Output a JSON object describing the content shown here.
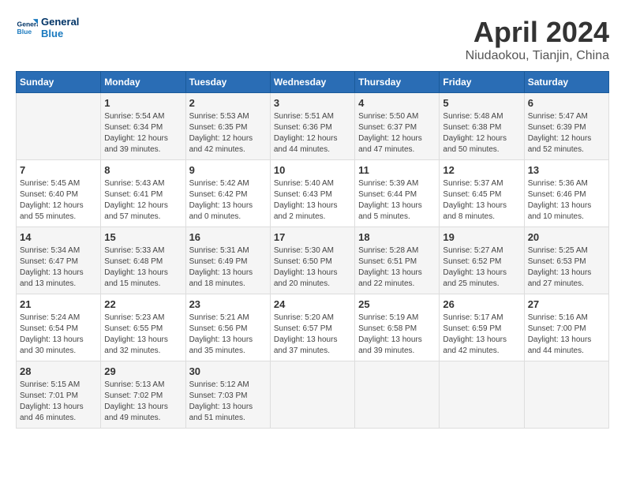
{
  "logo": {
    "line1": "General",
    "line2": "Blue"
  },
  "title": "April 2024",
  "subtitle": "Niudaokou, Tianjin, China",
  "days_of_week": [
    "Sunday",
    "Monday",
    "Tuesday",
    "Wednesday",
    "Thursday",
    "Friday",
    "Saturday"
  ],
  "weeks": [
    [
      {
        "day": "",
        "info": ""
      },
      {
        "day": "1",
        "info": "Sunrise: 5:54 AM\nSunset: 6:34 PM\nDaylight: 12 hours\nand 39 minutes."
      },
      {
        "day": "2",
        "info": "Sunrise: 5:53 AM\nSunset: 6:35 PM\nDaylight: 12 hours\nand 42 minutes."
      },
      {
        "day": "3",
        "info": "Sunrise: 5:51 AM\nSunset: 6:36 PM\nDaylight: 12 hours\nand 44 minutes."
      },
      {
        "day": "4",
        "info": "Sunrise: 5:50 AM\nSunset: 6:37 PM\nDaylight: 12 hours\nand 47 minutes."
      },
      {
        "day": "5",
        "info": "Sunrise: 5:48 AM\nSunset: 6:38 PM\nDaylight: 12 hours\nand 50 minutes."
      },
      {
        "day": "6",
        "info": "Sunrise: 5:47 AM\nSunset: 6:39 PM\nDaylight: 12 hours\nand 52 minutes."
      }
    ],
    [
      {
        "day": "7",
        "info": "Sunrise: 5:45 AM\nSunset: 6:40 PM\nDaylight: 12 hours\nand 55 minutes."
      },
      {
        "day": "8",
        "info": "Sunrise: 5:43 AM\nSunset: 6:41 PM\nDaylight: 12 hours\nand 57 minutes."
      },
      {
        "day": "9",
        "info": "Sunrise: 5:42 AM\nSunset: 6:42 PM\nDaylight: 13 hours\nand 0 minutes."
      },
      {
        "day": "10",
        "info": "Sunrise: 5:40 AM\nSunset: 6:43 PM\nDaylight: 13 hours\nand 2 minutes."
      },
      {
        "day": "11",
        "info": "Sunrise: 5:39 AM\nSunset: 6:44 PM\nDaylight: 13 hours\nand 5 minutes."
      },
      {
        "day": "12",
        "info": "Sunrise: 5:37 AM\nSunset: 6:45 PM\nDaylight: 13 hours\nand 8 minutes."
      },
      {
        "day": "13",
        "info": "Sunrise: 5:36 AM\nSunset: 6:46 PM\nDaylight: 13 hours\nand 10 minutes."
      }
    ],
    [
      {
        "day": "14",
        "info": "Sunrise: 5:34 AM\nSunset: 6:47 PM\nDaylight: 13 hours\nand 13 minutes."
      },
      {
        "day": "15",
        "info": "Sunrise: 5:33 AM\nSunset: 6:48 PM\nDaylight: 13 hours\nand 15 minutes."
      },
      {
        "day": "16",
        "info": "Sunrise: 5:31 AM\nSunset: 6:49 PM\nDaylight: 13 hours\nand 18 minutes."
      },
      {
        "day": "17",
        "info": "Sunrise: 5:30 AM\nSunset: 6:50 PM\nDaylight: 13 hours\nand 20 minutes."
      },
      {
        "day": "18",
        "info": "Sunrise: 5:28 AM\nSunset: 6:51 PM\nDaylight: 13 hours\nand 22 minutes."
      },
      {
        "day": "19",
        "info": "Sunrise: 5:27 AM\nSunset: 6:52 PM\nDaylight: 13 hours\nand 25 minutes."
      },
      {
        "day": "20",
        "info": "Sunrise: 5:25 AM\nSunset: 6:53 PM\nDaylight: 13 hours\nand 27 minutes."
      }
    ],
    [
      {
        "day": "21",
        "info": "Sunrise: 5:24 AM\nSunset: 6:54 PM\nDaylight: 13 hours\nand 30 minutes."
      },
      {
        "day": "22",
        "info": "Sunrise: 5:23 AM\nSunset: 6:55 PM\nDaylight: 13 hours\nand 32 minutes."
      },
      {
        "day": "23",
        "info": "Sunrise: 5:21 AM\nSunset: 6:56 PM\nDaylight: 13 hours\nand 35 minutes."
      },
      {
        "day": "24",
        "info": "Sunrise: 5:20 AM\nSunset: 6:57 PM\nDaylight: 13 hours\nand 37 minutes."
      },
      {
        "day": "25",
        "info": "Sunrise: 5:19 AM\nSunset: 6:58 PM\nDaylight: 13 hours\nand 39 minutes."
      },
      {
        "day": "26",
        "info": "Sunrise: 5:17 AM\nSunset: 6:59 PM\nDaylight: 13 hours\nand 42 minutes."
      },
      {
        "day": "27",
        "info": "Sunrise: 5:16 AM\nSunset: 7:00 PM\nDaylight: 13 hours\nand 44 minutes."
      }
    ],
    [
      {
        "day": "28",
        "info": "Sunrise: 5:15 AM\nSunset: 7:01 PM\nDaylight: 13 hours\nand 46 minutes."
      },
      {
        "day": "29",
        "info": "Sunrise: 5:13 AM\nSunset: 7:02 PM\nDaylight: 13 hours\nand 49 minutes."
      },
      {
        "day": "30",
        "info": "Sunrise: 5:12 AM\nSunset: 7:03 PM\nDaylight: 13 hours\nand 51 minutes."
      },
      {
        "day": "",
        "info": ""
      },
      {
        "day": "",
        "info": ""
      },
      {
        "day": "",
        "info": ""
      },
      {
        "day": "",
        "info": ""
      }
    ]
  ]
}
